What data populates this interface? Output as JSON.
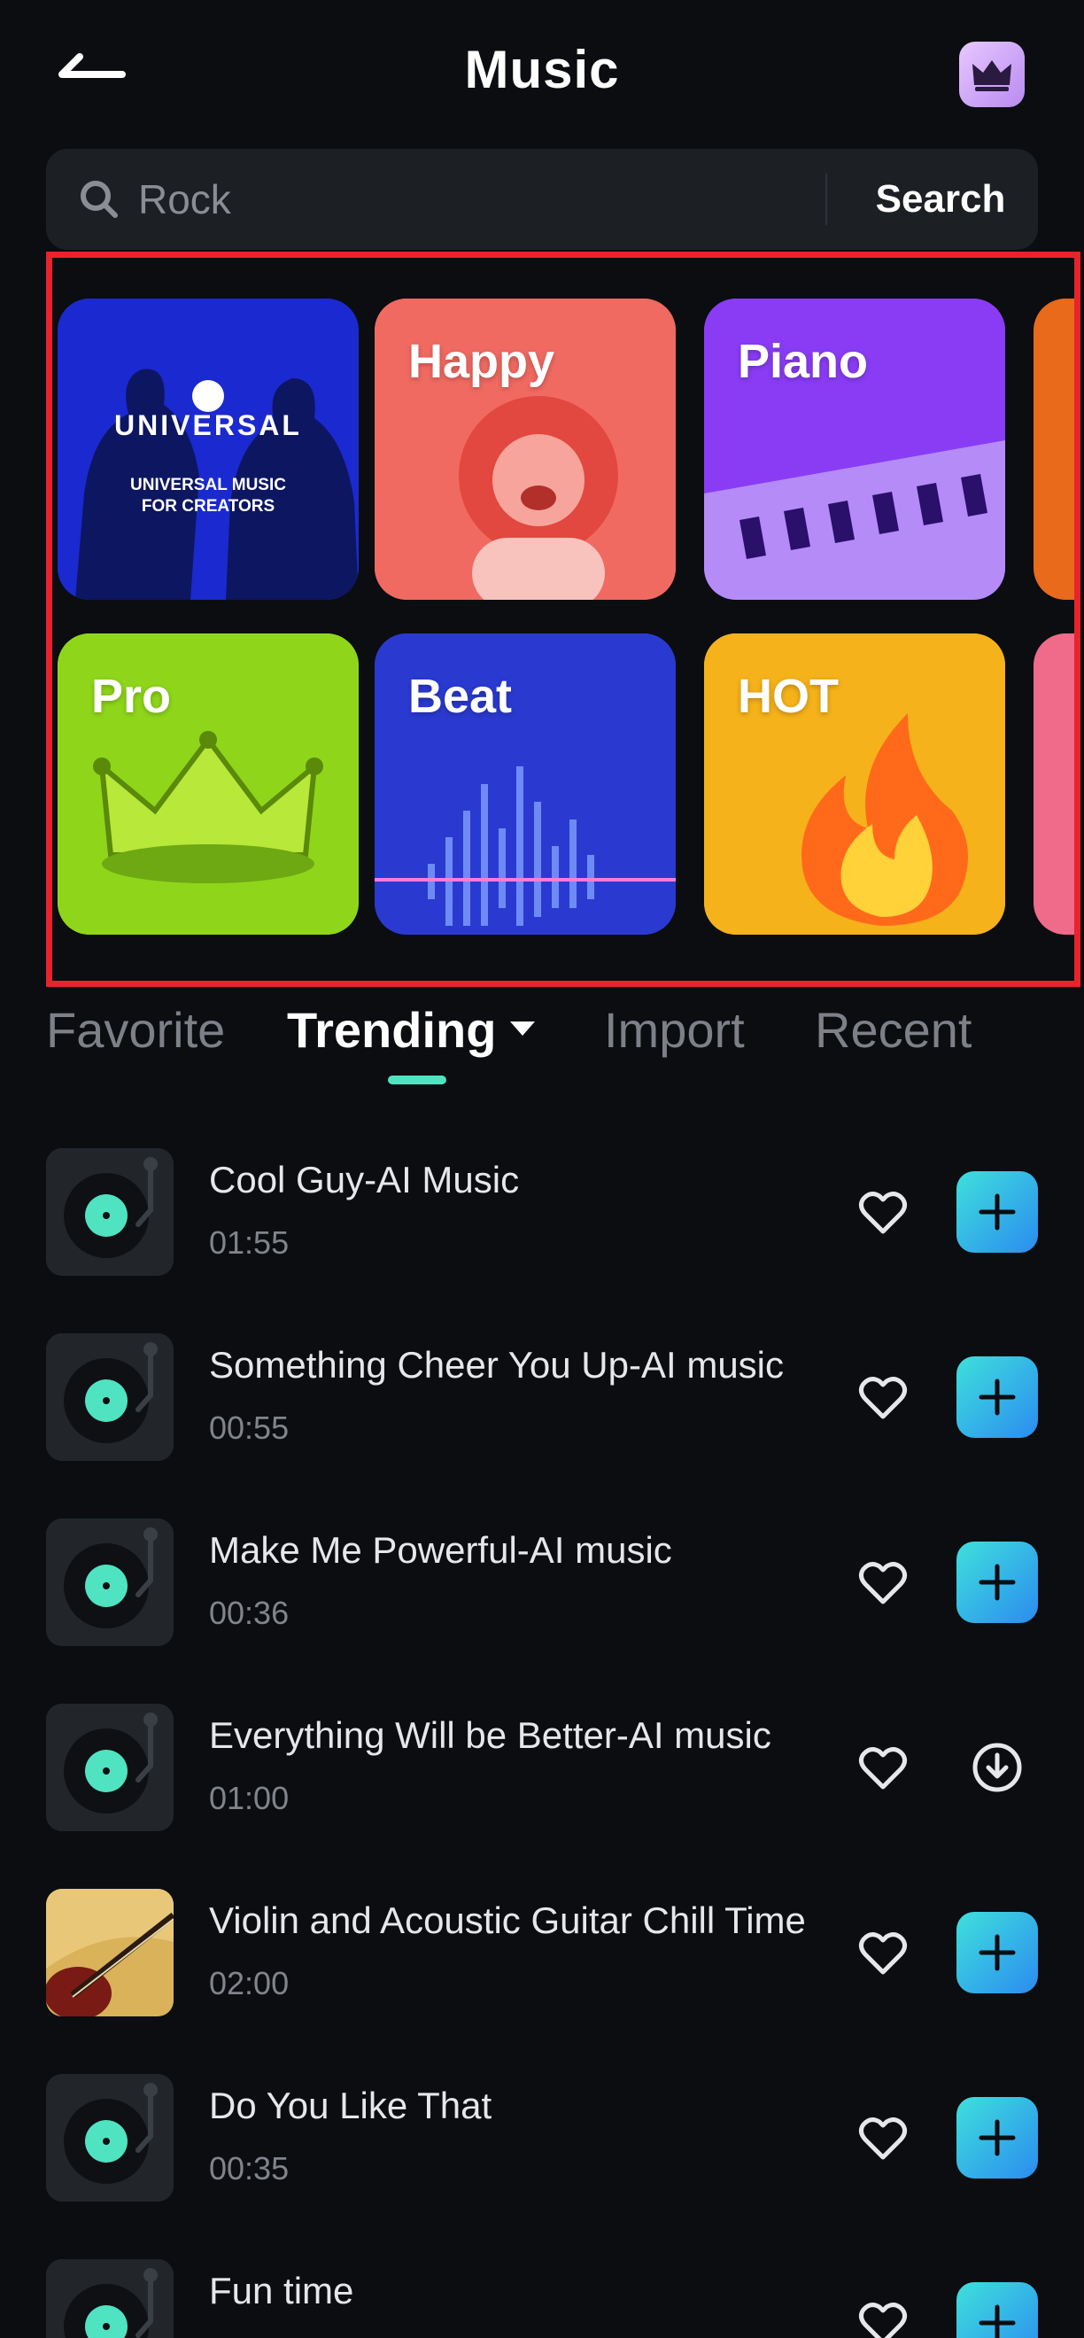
{
  "header": {
    "title": "Music"
  },
  "search": {
    "placeholder": "Rock",
    "button_label": "Search"
  },
  "categories": [
    {
      "label": "",
      "logo_text": "UNIVERSAL",
      "subtitle_line1": "UNIVERSAL MUSIC",
      "subtitle_line2": "FOR CREATORS",
      "color": "#1a2ad0"
    },
    {
      "label": "Happy",
      "color": "#f06a62"
    },
    {
      "label": "Piano",
      "color": "#8a3cf5"
    },
    {
      "label": "Pro",
      "color": "#8fd61a"
    },
    {
      "label": "Beat",
      "color": "#2a3ad0"
    },
    {
      "label": "HOT",
      "color": "#f5b21a"
    }
  ],
  "tabs": [
    {
      "label": "Favorite"
    },
    {
      "label": "Trending"
    },
    {
      "label": "Import"
    },
    {
      "label": "Recent"
    }
  ],
  "tracks": [
    {
      "title": "Cool Guy-AI Music",
      "duration": "01:55",
      "action": "add"
    },
    {
      "title": "Something Cheer You Up-AI music",
      "duration": "00:55",
      "action": "add"
    },
    {
      "title": "Make Me Powerful-AI music",
      "duration": "00:36",
      "action": "add"
    },
    {
      "title": "Everything Will be Better-AI music",
      "duration": "01:00",
      "action": "download"
    },
    {
      "title": "Violin and Acoustic Guitar Chill Time",
      "duration": "02:00",
      "action": "add"
    },
    {
      "title": "Do You Like That",
      "duration": "00:35",
      "action": "add"
    },
    {
      "title": "Fun time",
      "duration": "",
      "action": "add"
    }
  ],
  "colors": {
    "accent": "#4fe3c1",
    "add_button": "#2fb8e8",
    "background": "#0b0d10",
    "highlight_frame": "#e8232c"
  }
}
